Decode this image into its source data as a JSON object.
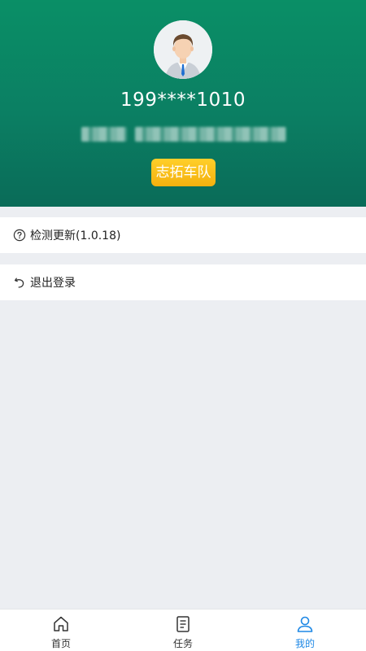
{
  "profile": {
    "phone": "199****1010",
    "team": "志拓车队",
    "avatar_icon": "user-avatar"
  },
  "menu": {
    "update": {
      "label": "检测更新(1.0.18)",
      "icon": "help-circle-icon"
    },
    "logout": {
      "label": "退出登录",
      "icon": "undo-arrow-icon"
    }
  },
  "tabbar": {
    "items": [
      {
        "label": "首页",
        "icon": "home-icon",
        "active": false
      },
      {
        "label": "任务",
        "icon": "document-icon",
        "active": false
      },
      {
        "label": "我的",
        "icon": "user-icon",
        "active": true
      }
    ]
  },
  "colors": {
    "header": "#0b7f63",
    "badge": "#f4b10e",
    "active_tab": "#1e88e5",
    "background": "#eceef2"
  }
}
